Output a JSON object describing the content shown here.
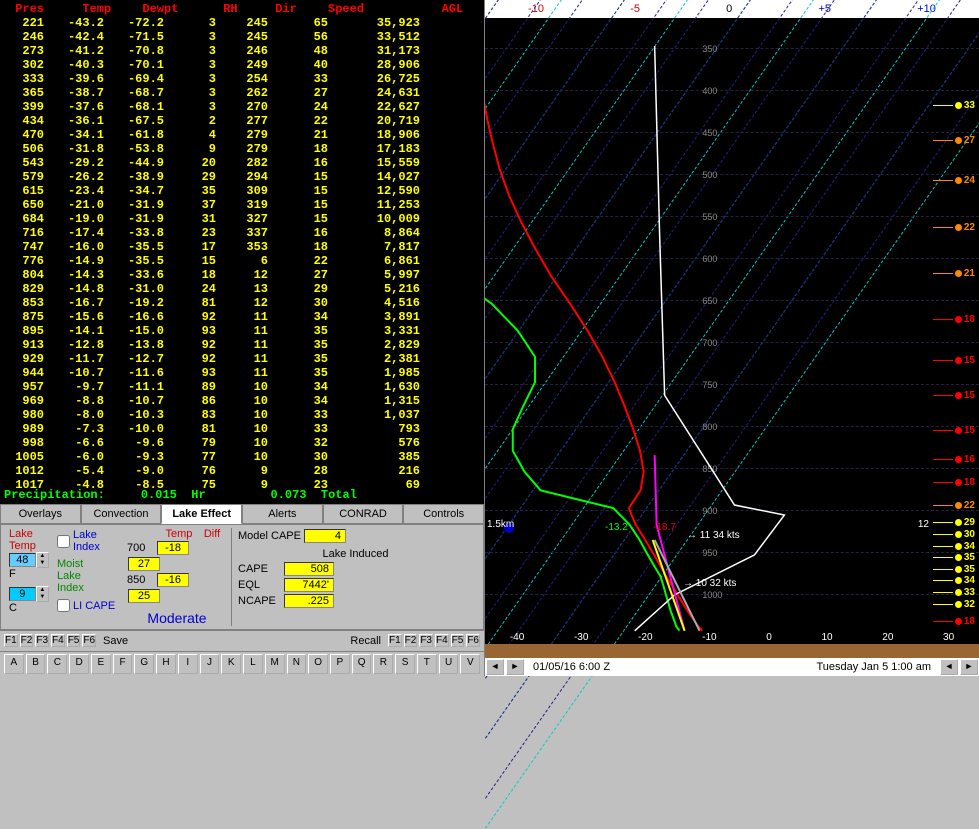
{
  "sounding": {
    "headers": {
      "pres": "Pres",
      "temp": "Temp",
      "dewpt": "Dewpt",
      "rh": "RH",
      "dir": "Dir",
      "speed": "Speed",
      "agl": "AGL"
    },
    "rows": [
      {
        "p": "221",
        "t": "-43.2",
        "d": "-72.2",
        "rh": "3",
        "dir": "245",
        "s": "65",
        "a": "35,923"
      },
      {
        "p": "246",
        "t": "-42.4",
        "d": "-71.5",
        "rh": "3",
        "dir": "245",
        "s": "56",
        "a": "33,512"
      },
      {
        "p": "273",
        "t": "-41.2",
        "d": "-70.8",
        "rh": "3",
        "dir": "246",
        "s": "48",
        "a": "31,173"
      },
      {
        "p": "302",
        "t": "-40.3",
        "d": "-70.1",
        "rh": "3",
        "dir": "249",
        "s": "40",
        "a": "28,906"
      },
      {
        "p": "333",
        "t": "-39.6",
        "d": "-69.4",
        "rh": "3",
        "dir": "254",
        "s": "33",
        "a": "26,725"
      },
      {
        "p": "365",
        "t": "-38.7",
        "d": "-68.7",
        "rh": "3",
        "dir": "262",
        "s": "27",
        "a": "24,631"
      },
      {
        "p": "399",
        "t": "-37.6",
        "d": "-68.1",
        "rh": "3",
        "dir": "270",
        "s": "24",
        "a": "22,627"
      },
      {
        "p": "434",
        "t": "-36.1",
        "d": "-67.5",
        "rh": "2",
        "dir": "277",
        "s": "22",
        "a": "20,719"
      },
      {
        "p": "470",
        "t": "-34.1",
        "d": "-61.8",
        "rh": "4",
        "dir": "279",
        "s": "21",
        "a": "18,906"
      },
      {
        "p": "506",
        "t": "-31.8",
        "d": "-53.8",
        "rh": "9",
        "dir": "279",
        "s": "18",
        "a": "17,183"
      },
      {
        "p": "543",
        "t": "-29.2",
        "d": "-44.9",
        "rh": "20",
        "dir": "282",
        "s": "16",
        "a": "15,559"
      },
      {
        "p": "579",
        "t": "-26.2",
        "d": "-38.9",
        "rh": "29",
        "dir": "294",
        "s": "15",
        "a": "14,027"
      },
      {
        "p": "615",
        "t": "-23.4",
        "d": "-34.7",
        "rh": "35",
        "dir": "309",
        "s": "15",
        "a": "12,590"
      },
      {
        "p": "650",
        "t": "-21.0",
        "d": "-31.9",
        "rh": "37",
        "dir": "319",
        "s": "15",
        "a": "11,253"
      },
      {
        "p": "684",
        "t": "-19.0",
        "d": "-31.9",
        "rh": "31",
        "dir": "327",
        "s": "15",
        "a": "10,009"
      },
      {
        "p": "716",
        "t": "-17.4",
        "d": "-33.8",
        "rh": "23",
        "dir": "337",
        "s": "16",
        "a": "8,864"
      },
      {
        "p": "747",
        "t": "-16.0",
        "d": "-35.5",
        "rh": "17",
        "dir": "353",
        "s": "18",
        "a": "7,817"
      },
      {
        "p": "776",
        "t": "-14.9",
        "d": "-35.5",
        "rh": "15",
        "dir": "6",
        "s": "22",
        "a": "6,861"
      },
      {
        "p": "804",
        "t": "-14.3",
        "d": "-33.6",
        "rh": "18",
        "dir": "12",
        "s": "27",
        "a": "5,997"
      },
      {
        "p": "829",
        "t": "-14.8",
        "d": "-31.0",
        "rh": "24",
        "dir": "13",
        "s": "29",
        "a": "5,216"
      },
      {
        "p": "853",
        "t": "-16.7",
        "d": "-19.2",
        "rh": "81",
        "dir": "12",
        "s": "30",
        "a": "4,516"
      },
      {
        "p": "875",
        "t": "-15.6",
        "d": "-16.6",
        "rh": "92",
        "dir": "11",
        "s": "34",
        "a": "3,891"
      },
      {
        "p": "895",
        "t": "-14.1",
        "d": "-15.0",
        "rh": "93",
        "dir": "11",
        "s": "35",
        "a": "3,331"
      },
      {
        "p": "913",
        "t": "-12.8",
        "d": "-13.8",
        "rh": "92",
        "dir": "11",
        "s": "35",
        "a": "2,829"
      },
      {
        "p": "929",
        "t": "-11.7",
        "d": "-12.7",
        "rh": "92",
        "dir": "11",
        "s": "35",
        "a": "2,381"
      },
      {
        "p": "944",
        "t": "-10.7",
        "d": "-11.6",
        "rh": "93",
        "dir": "11",
        "s": "35",
        "a": "1,985"
      },
      {
        "p": "957",
        "t": "-9.7",
        "d": "-11.1",
        "rh": "89",
        "dir": "10",
        "s": "34",
        "a": "1,630"
      },
      {
        "p": "969",
        "t": "-8.8",
        "d": "-10.7",
        "rh": "86",
        "dir": "10",
        "s": "34",
        "a": "1,315"
      },
      {
        "p": "980",
        "t": "-8.0",
        "d": "-10.3",
        "rh": "83",
        "dir": "10",
        "s": "33",
        "a": "1,037"
      },
      {
        "p": "989",
        "t": "-7.3",
        "d": "-10.0",
        "rh": "81",
        "dir": "10",
        "s": "33",
        "a": "793"
      },
      {
        "p": "998",
        "t": "-6.6",
        "d": "-9.6",
        "rh": "79",
        "dir": "10",
        "s": "32",
        "a": "576"
      },
      {
        "p": "1005",
        "t": "-6.0",
        "d": "-9.3",
        "rh": "77",
        "dir": "10",
        "s": "30",
        "a": "385"
      },
      {
        "p": "1012",
        "t": "-5.4",
        "d": "-9.0",
        "rh": "76",
        "dir": "9",
        "s": "28",
        "a": "216"
      },
      {
        "p": "1017",
        "t": "-4.8",
        "d": "-8.5",
        "rh": "75",
        "dir": "9",
        "s": "23",
        "a": "69"
      }
    ]
  },
  "precip": {
    "label": "Precipitation:",
    "hr_val": "0.015",
    "hr_lbl": "Hr",
    "tot_val": "0.073",
    "tot_lbl": "Total"
  },
  "tabs": [
    "Overlays",
    "Convection",
    "Lake Effect",
    "Alerts",
    "CONRAD",
    "Controls"
  ],
  "active_tab": 2,
  "lake": {
    "lake_temp_hdr": "Lake\nTemp",
    "hi_temp": "48",
    "hi_unit": "F",
    "lo_temp": "9",
    "lo_unit": "C",
    "lake_index": "Lake\nIndex",
    "moist": "Moist\nLake\nIndex",
    "li_cape": "LI CAPE",
    "temp_hdr": "Temp",
    "diff_hdr": "Diff",
    "l700": "700",
    "t700": "-18",
    "d700": "27",
    "l850": "850",
    "t850": "-16",
    "d850": "25",
    "rating": "Moderate",
    "mc_hdr": "Model CAPE",
    "mc_val": "4",
    "li_hdr": "Lake Induced",
    "cape_l": "CAPE",
    "cape_v": "508",
    "eql_l": "EQL",
    "eql_v": "7442'",
    "ncape_l": "NCAPE",
    "ncape_v": ".225"
  },
  "fn": {
    "btns": [
      "F1",
      "F2",
      "F3",
      "F4",
      "F5",
      "F6"
    ],
    "save": "Save",
    "recall": "Recall"
  },
  "letters": [
    "A",
    "B",
    "C",
    "D",
    "E",
    "F",
    "G",
    "H",
    "I",
    "J",
    "K",
    "L",
    "M",
    "N",
    "O",
    "P",
    "Q",
    "R",
    "S",
    "T",
    "U",
    "V"
  ],
  "chart_data": {
    "type": "line",
    "top_axis": [
      "-10",
      "-5",
      "0",
      "+5",
      "+10"
    ],
    "y_ticks": [
      "350",
      "400",
      "450",
      "500",
      "550",
      "600",
      "650",
      "700",
      "750",
      "800",
      "850",
      "900",
      "950",
      "1000"
    ],
    "bot_axis": [
      "-40",
      "-30",
      "-20",
      "-10",
      "0",
      "10",
      "20",
      "30"
    ],
    "series": [
      {
        "name": "dewpoint",
        "color": "#0f0",
        "x": "Dewpt",
        "y": "Pres"
      },
      {
        "name": "temperature",
        "color": "#f00",
        "x": "Temp",
        "y": "Pres"
      },
      {
        "name": "parcel",
        "color": "#fff"
      },
      {
        "name": "wet-bulb",
        "color": "#f0f"
      }
    ],
    "winds": [
      {
        "p": 11,
        "s": "33",
        "c": "y"
      },
      {
        "p": 17,
        "s": "27",
        "c": "o"
      },
      {
        "p": 24,
        "s": "24",
        "c": "o"
      },
      {
        "p": 32,
        "s": "22",
        "c": "o"
      },
      {
        "p": 40,
        "s": "21",
        "c": "o"
      },
      {
        "p": 48,
        "s": "18",
        "c": "r"
      },
      {
        "p": 55,
        "s": "15",
        "c": "r"
      },
      {
        "p": 61,
        "s": "15",
        "c": "r"
      },
      {
        "p": 67,
        "s": "15",
        "c": "r"
      },
      {
        "p": 72,
        "s": "16",
        "c": "r"
      },
      {
        "p": 76,
        "s": "18",
        "c": "r"
      },
      {
        "p": 80,
        "s": "22",
        "c": "o"
      },
      {
        "p": 83,
        "s": "29",
        "c": "y"
      },
      {
        "p": 85,
        "s": "30",
        "c": "y"
      },
      {
        "p": 87,
        "s": "34",
        "c": "y"
      },
      {
        "p": 89,
        "s": "35",
        "c": "y"
      },
      {
        "p": 91,
        "s": "35",
        "c": "y"
      },
      {
        "p": 93,
        "s": "34",
        "c": "y"
      },
      {
        "p": 95,
        "s": "33",
        "c": "y"
      },
      {
        "p": 97,
        "s": "32",
        "c": "y"
      },
      {
        "p": 100,
        "s": "18",
        "c": "r"
      }
    ],
    "left_ann": "1.5km",
    "left_ann2": "12",
    "temp_lbls": {
      "g": "-13.2",
      "r": "-18.7"
    },
    "wind_txt1": "11   34 kts",
    "wind_txt2": "10   32 kts"
  },
  "timebar": {
    "dt": "01/05/16   6:00 Z",
    "day": "Tuesday   Jan 5  1:00 am"
  }
}
